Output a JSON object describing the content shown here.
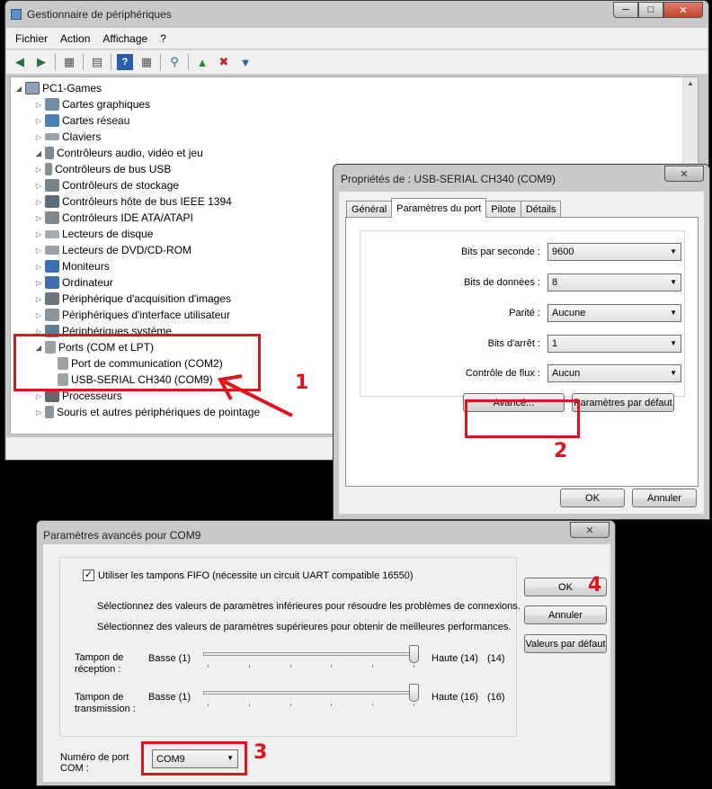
{
  "device_manager": {
    "title": "Gestionnaire de périphériques",
    "menu": [
      "Fichier",
      "Action",
      "Affichage",
      "?"
    ],
    "root": "PC1-Games",
    "items": [
      "Cartes graphiques",
      "Cartes réseau",
      "Claviers",
      "Contrôleurs audio, vidéo et jeu",
      "Contrôleurs de bus USB",
      "Contrôleurs de stockage",
      "Contrôleurs hôte de bus IEEE 1394",
      "Contrôleurs IDE ATA/ATAPI",
      "Lecteurs de disque",
      "Lecteurs de DVD/CD-ROM",
      "Moniteurs",
      "Ordinateur",
      "Périphérique d'acquisition d'images",
      "Périphériques d'interface utilisateur",
      "Périphériques système",
      "Ports (COM et LPT)",
      "Processeurs",
      "Souris et autres périphériques de pointage"
    ],
    "ports_children": [
      "Port de communication (COM2)",
      "USB-SERIAL CH340 (COM9)"
    ]
  },
  "properties": {
    "title": "Propriétés de : USB-SERIAL CH340 (COM9)",
    "tabs": [
      "Général",
      "Paramètres du port",
      "Pilote",
      "Détails"
    ],
    "fields": [
      {
        "label": "Bits par seconde :",
        "value": "9600"
      },
      {
        "label": "Bits de données :",
        "value": "8"
      },
      {
        "label": "Parité :",
        "value": "Aucune"
      },
      {
        "label": "Bits d'arrêt :",
        "value": "1"
      },
      {
        "label": "Contrôle de flux :",
        "value": "Aucun"
      }
    ],
    "advanced_button": "Avancé...",
    "defaults_button": "Paramètres par défaut",
    "ok_button": "OK",
    "cancel_button": "Annuler"
  },
  "advanced": {
    "title": "Paramètres avancés pour COM9",
    "fifo_label": "Utiliser les tampons FIFO (nécessite un circuit UART compatible 16550)",
    "fifo_checked": true,
    "hint_low": "Sélectionnez des valeurs de paramètres inférieures pour résoudre les problèmes de connexions.",
    "hint_high": "Sélectionnez des valeurs de paramètres supérieures pour obtenir de meilleures performances.",
    "rx_label_1": "Tampon de",
    "rx_label_2": "réception :",
    "tx_label_1": "Tampon de",
    "tx_label_2": "transmission :",
    "rx_low": "Basse (1)",
    "rx_high": "Haute (14)",
    "rx_value": "(14)",
    "rx_level": 1.0,
    "tx_low": "Basse (1)",
    "tx_high": "Haute (16)",
    "tx_value": "(16)",
    "tx_level": 1.0,
    "port_label_1": "Numéro de port",
    "port_label_2": "COM :",
    "port_value": "COM9",
    "ok_button": "OK",
    "cancel_button": "Annuler",
    "defaults_button": "Valeurs par défaut"
  },
  "annotations": {
    "n1": "1",
    "n2": "2",
    "n3": "3",
    "n4": "4",
    "color": "#e0141c"
  }
}
